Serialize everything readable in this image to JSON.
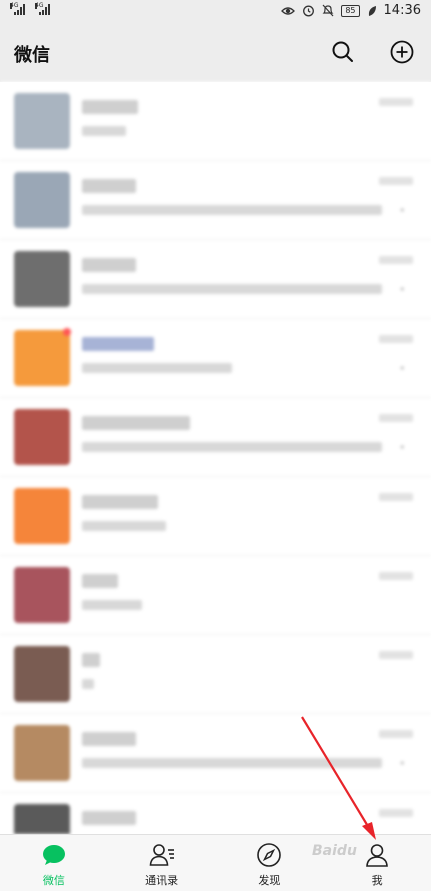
{
  "status_bar": {
    "sim1": "4G",
    "sim2": "4G",
    "battery": "85",
    "time": "14:36"
  },
  "header": {
    "title": "微信",
    "search_icon": "search-icon",
    "add_icon": "plus-circle-icon"
  },
  "chats": [
    {
      "avatar_color": "#a9b4c0",
      "name_color": "#cfcfcf",
      "name_w": 56,
      "msg_w": 44,
      "muted": false,
      "badge": false
    },
    {
      "avatar_color": "#9aa7b6",
      "name_color": "#cfcfcf",
      "name_w": 54,
      "msg_w": 300,
      "muted": true,
      "badge": false
    },
    {
      "avatar_color": "#6e6e6e",
      "name_color": "#cfcfcf",
      "name_w": 54,
      "msg_w": 300,
      "muted": true,
      "badge": false
    },
    {
      "avatar_color": "#f59a3c",
      "name_color": "#a7b3d6",
      "name_w": 72,
      "msg_w": 150,
      "muted": true,
      "badge": true
    },
    {
      "avatar_color": "#b3544b",
      "name_color": "#cfcfcf",
      "name_w": 108,
      "msg_w": 300,
      "muted": true,
      "badge": false
    },
    {
      "avatar_color": "#f5853a",
      "name_color": "#cfcfcf",
      "name_w": 76,
      "msg_w": 84,
      "muted": false,
      "badge": false
    },
    {
      "avatar_color": "#a8545d",
      "name_color": "#cfcfcf",
      "name_w": 36,
      "msg_w": 60,
      "muted": false,
      "badge": false
    },
    {
      "avatar_color": "#7a5c52",
      "name_color": "#cfcfcf",
      "name_w": 18,
      "msg_w": 12,
      "muted": false,
      "badge": false
    },
    {
      "avatar_color": "#b58a62",
      "name_color": "#cfcfcf",
      "name_w": 54,
      "msg_w": 300,
      "muted": true,
      "badge": false
    },
    {
      "avatar_color": "#5a5a5a",
      "name_color": "#cfcfcf",
      "name_w": 54,
      "msg_w": 90,
      "muted": false,
      "badge": false
    }
  ],
  "tabs": [
    {
      "label": "微信",
      "icon": "chat-bubble-icon",
      "active": true
    },
    {
      "label": "通讯录",
      "icon": "contacts-icon",
      "active": false
    },
    {
      "label": "发现",
      "icon": "compass-icon",
      "active": false
    },
    {
      "label": "我",
      "icon": "person-icon",
      "active": false
    }
  ],
  "watermark": "Baidu",
  "colors": {
    "accent": "#07c160",
    "arrow": "#e8242a",
    "header_bg": "#ededed"
  }
}
